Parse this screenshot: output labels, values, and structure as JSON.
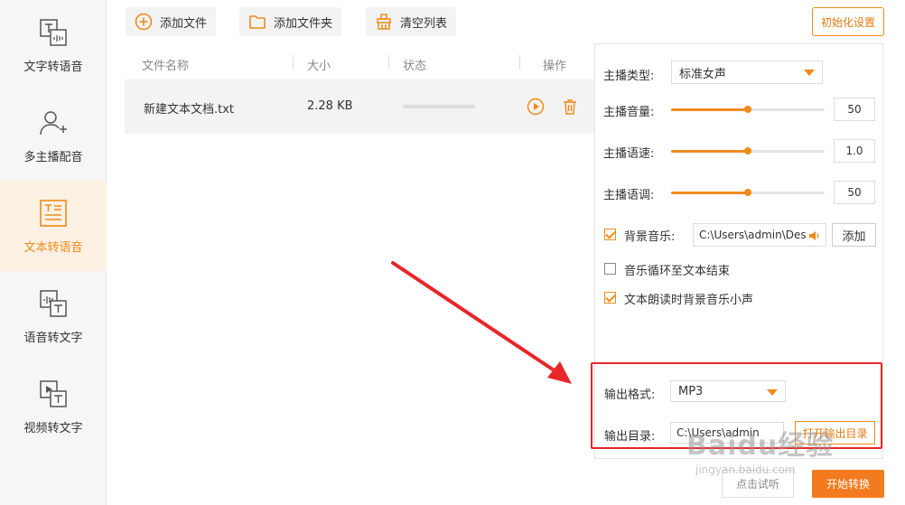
{
  "sidebar": {
    "items": [
      {
        "label": "文字转语音",
        "icon": "text-to-speech-icon",
        "active": false
      },
      {
        "label": "多主播配音",
        "icon": "multi-anchor-icon",
        "active": false
      },
      {
        "label": "文本转语音",
        "icon": "document-to-speech-icon",
        "active": true
      },
      {
        "label": "语音转文字",
        "icon": "speech-to-text-icon",
        "active": false
      },
      {
        "label": "视频转文字",
        "icon": "video-to-text-icon",
        "active": false
      }
    ]
  },
  "toolbar": {
    "add_file": "添加文件",
    "add_folder": "添加文件夹",
    "clear_list": "清空列表",
    "init_settings": "初始化设置"
  },
  "table": {
    "headers": [
      "文件名称",
      "大小",
      "状态",
      "操作"
    ],
    "rows": [
      {
        "name": "新建文本文档.txt",
        "size": "2.28 KB",
        "progress": 0
      }
    ]
  },
  "settings": {
    "anchor_type_label": "主播类型:",
    "anchor_type_value": "标准女声",
    "volume_label": "主播音量:",
    "volume_value": "50",
    "volume_fraction": 0.5,
    "speed_label": "主播语速:",
    "speed_value": "1.0",
    "speed_fraction": 0.5,
    "pitch_label": "主播语调:",
    "pitch_value": "50",
    "pitch_fraction": 0.5,
    "bg_music_label": "背景音乐:",
    "bg_music_checked": true,
    "bg_music_path": "C:\\Users\\admin\\Des",
    "bg_music_add": "添加",
    "loop_label": "音乐循环至文本结束",
    "loop_checked": false,
    "duck_label": "文本朗读时背景音乐小声",
    "duck_checked": true,
    "output_format_label": "输出格式:",
    "output_format_value": "MP3",
    "output_dir_label": "输出目录:",
    "output_dir_value": "C:\\Users\\admin",
    "open_output_dir": "打开输出目录"
  },
  "bottom": {
    "try_listen": "点击试听",
    "start_convert": "开始转换"
  },
  "watermark": {
    "logo": "Baidu经验",
    "url": "jingyan.baidu.com"
  },
  "colors": {
    "accent": "#f08a1c",
    "start_button": "#f27b1f",
    "highlight": "#e8262a"
  }
}
